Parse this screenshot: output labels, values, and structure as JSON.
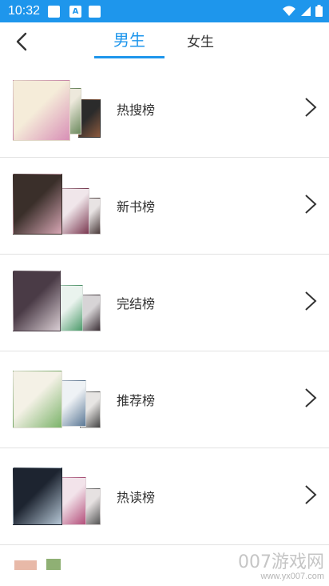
{
  "status": {
    "time": "10:32",
    "mid_icon_letter": "A"
  },
  "header": {
    "tabs": [
      "男生",
      "女生"
    ]
  },
  "rows": [
    {
      "label": "热搜榜",
      "covers": [
        [
          "#f5ecd9",
          "#d88fb6"
        ],
        [
          "#ede9dc",
          "#6b8a5d"
        ],
        [
          "#2b2b2b",
          "#8c5a3e"
        ]
      ]
    },
    {
      "label": "新书榜",
      "covers": [
        [
          "#3a2f2a",
          "#d7a6b4"
        ],
        [
          "#f0e6ea",
          "#7a3850"
        ],
        [
          "#e8e3e3",
          "#4a3a3a"
        ]
      ]
    },
    {
      "label": "完结榜",
      "covers": [
        [
          "#4a3b46",
          "#d9cdd3"
        ],
        [
          "#eaf3ee",
          "#4c9b6b"
        ],
        [
          "#d7d4d6",
          "#3b3036"
        ]
      ]
    },
    {
      "label": "推荐榜",
      "covers": [
        [
          "#f4f1e6",
          "#7bb36a"
        ],
        [
          "#eef2f5",
          "#5b7896"
        ],
        [
          "#e7e5e3",
          "#444"
        ]
      ]
    },
    {
      "label": "热读榜",
      "covers": [
        [
          "#1d2430",
          "#b6c7d6"
        ],
        [
          "#f2e3ea",
          "#b34e7a"
        ],
        [
          "#e6e1e1",
          "#555"
        ]
      ]
    }
  ],
  "watermark": {
    "main": "007游戏网",
    "sub": "www.yx007.com"
  },
  "colors": {
    "accent": "#1e96ec"
  }
}
